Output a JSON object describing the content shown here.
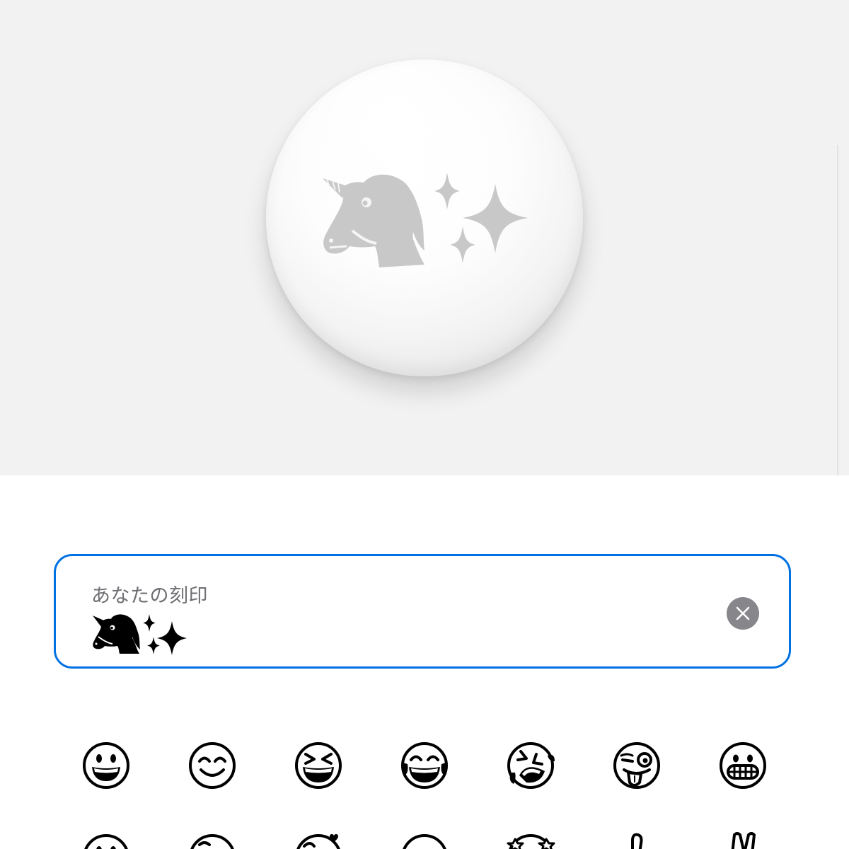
{
  "engraving_input": {
    "label": "あなたの刻印",
    "value_emojis": [
      "unicorn-icon",
      "sparkles-icon"
    ],
    "clear_button": "clear-icon"
  },
  "preview": {
    "engraved_emojis": [
      "unicorn-icon",
      "sparkles-icon"
    ]
  },
  "emoji_picker": {
    "rows": [
      [
        "grinning-face",
        "smiling-face-with-smiling-eyes",
        "grinning-squinting-face",
        "face-with-tears-of-joy",
        "rolling-on-the-floor-laughing",
        "winking-face-with-tongue",
        "grimacing-face"
      ],
      [
        "smiling-face",
        "face",
        "smiling-face-with-heart",
        "face",
        "star-struck-face",
        "thumbs-up",
        "victory-hand"
      ]
    ]
  },
  "colors": {
    "accent": "#0071e3",
    "preview_background": "#f2f2f2",
    "clear_button": "#86868b",
    "label": "#6e6e73",
    "engraving": "#c8c8c8"
  }
}
